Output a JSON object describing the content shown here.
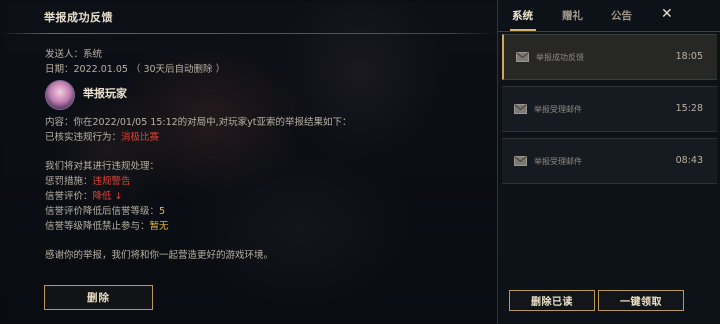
{
  "detail": {
    "title": "举报成功反馈",
    "sender_prefix": "发送人：",
    "sender": "系统",
    "date_prefix": "日期：",
    "date": "2022.01.05",
    "date_note": "（ 30天后自动删除 ）",
    "sender_name": "举报玩家",
    "content_line1": "内容：你在2022/01/05 15:12的对局中,对玩家yt亚索的举报结果如下：",
    "violation_prefix": "已核实违规行为：",
    "violation": "消极比赛",
    "punish_intro": "我们将对其进行违规处理：",
    "penalty_prefix": "惩罚措施：",
    "penalty": "违规警告",
    "credit_prefix": "信誉评价：",
    "credit": "降低 ↓",
    "level_prefix": "信誉评价降低后信誉等级：",
    "level": "5",
    "ban_prefix": "信誉等级降低禁止参与：",
    "ban": "暂无",
    "thanks": "感谢你的举报，我们将和你一起营造更好的游戏环境。",
    "delete_label": "删除"
  },
  "tabs": [
    {
      "label": "系统"
    },
    {
      "label": "赠礼"
    },
    {
      "label": "公告"
    }
  ],
  "close_label": "✕",
  "mails": [
    {
      "subject": "举报成功反馈",
      "time": "18:05"
    },
    {
      "subject": "举报受理邮件",
      "time": "15:28"
    },
    {
      "subject": "举报受理邮件",
      "time": "08:43"
    }
  ],
  "actions": {
    "delete_read": "删除已读",
    "claim_all": "一键领取"
  },
  "colors": {
    "accent_gold": "#d7b46a",
    "warning_red": "#e0423a",
    "level_gold": "#e6b93a"
  }
}
